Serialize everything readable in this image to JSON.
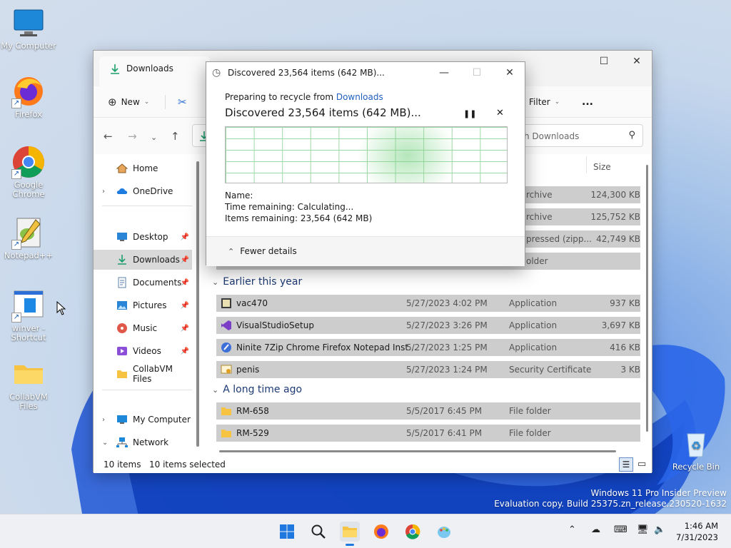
{
  "desktop": {
    "icons": [
      {
        "label": "My Computer"
      },
      {
        "label": "Firefox"
      },
      {
        "label": "Google Chrome"
      },
      {
        "label": "Notepad++"
      },
      {
        "label": "winver - Shortcut"
      },
      {
        "label": "CollabVM Files"
      },
      {
        "label": "Recycle Bin"
      }
    ],
    "watermark": {
      "line1": "Windows 11 Pro Insider Preview",
      "line2": "Evaluation copy. Build 25375.zn_release.230520-1632"
    }
  },
  "explorer": {
    "tab_title": "Downloads",
    "toolbar": {
      "new_label": "New",
      "filter_label": "Filter",
      "more_label": "..."
    },
    "search_placeholder": "Search Downloads",
    "search_visible": "h Downloads",
    "column_size": "Size",
    "sidebar": {
      "home": "Home",
      "onedrive": "OneDrive",
      "desktop": "Desktop",
      "downloads": "Downloads",
      "documents": "Documents",
      "pictures": "Pictures",
      "music": "Music",
      "videos": "Videos",
      "collabvm": "CollabVM Files",
      "mycomputer": "My Computer",
      "network": "Network"
    },
    "top_rows": [
      {
        "type": "rchive",
        "size": "124,300 KB"
      },
      {
        "type": "rchive",
        "size": "125,752 KB"
      },
      {
        "type": "pressed (zipp...",
        "size": "42,749 KB"
      },
      {
        "type": "older",
        "size": ""
      }
    ],
    "groups": [
      {
        "title": "Earlier this year",
        "rows": [
          {
            "name": "vac470",
            "date": "5/27/2023 4:02 PM",
            "type": "Application",
            "size": "937 KB"
          },
          {
            "name": "VisualStudioSetup",
            "date": "5/27/2023 3:26 PM",
            "type": "Application",
            "size": "3,697 KB"
          },
          {
            "name": "Ninite 7Zip Chrome Firefox Notepad Inst...",
            "date": "5/27/2023 1:25 PM",
            "type": "Application",
            "size": "416 KB"
          },
          {
            "name": "penis",
            "date": "5/27/2023 1:24 PM",
            "type": "Security Certificate",
            "size": "3 KB"
          }
        ]
      },
      {
        "title": "A long time ago",
        "rows": [
          {
            "name": "RM-658",
            "date": "5/5/2017 6:45 PM",
            "type": "File folder",
            "size": ""
          },
          {
            "name": "RM-529",
            "date": "5/5/2017 6:41 PM",
            "type": "File folder",
            "size": ""
          }
        ]
      }
    ],
    "status": {
      "items": "10 items",
      "selected": "10 items selected"
    }
  },
  "dialog": {
    "title": "Discovered 23,564 items (642 MB)...",
    "preparing_prefix": "Preparing to recycle from ",
    "preparing_link": "Downloads",
    "heading": "Discovered 23,564 items (642 MB)...",
    "name_label": "Name:",
    "time_remaining": "Time remaining:  Calculating...",
    "items_remaining": "Items remaining:  23,564 (642 MB)",
    "fewer_details": "Fewer details"
  },
  "taskbar": {
    "time": "1:46 AM",
    "date": "7/31/2023"
  }
}
